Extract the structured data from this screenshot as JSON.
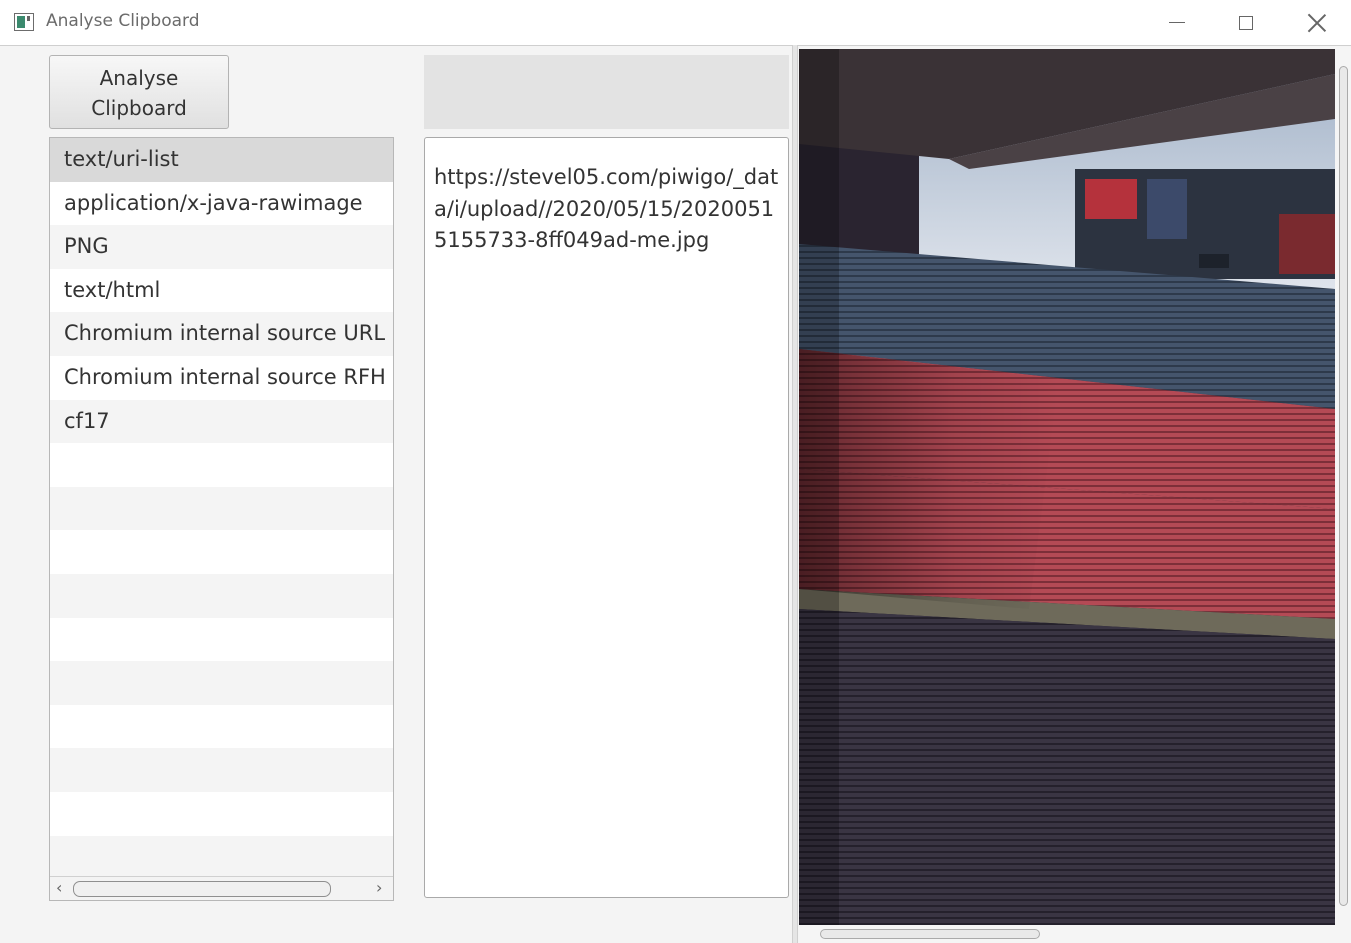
{
  "window": {
    "title": "Analyse Clipboard",
    "controls": [
      "minimize",
      "maximize",
      "close"
    ]
  },
  "toolbar": {
    "analyse_label_line1": "Analyse",
    "analyse_label_line2": "Clipboard"
  },
  "formats": {
    "items": [
      "text/uri-list",
      "application/x-java-rawimage",
      "PNG",
      "text/html",
      "Chromium internal source URL",
      "Chromium internal source RFH token",
      "cf17"
    ],
    "selected_index": 0
  },
  "content": {
    "text": "https://stevel05.com/piwigo/_data/i/upload//2020/05/15/20200515155733-8ff049ad-me.jpg"
  },
  "preview": {
    "description_icon": "stadium-photo"
  },
  "colors": {
    "selected_row": "#d9d9d9",
    "seat_red": "#b44a55",
    "seat_blue": "#3e4f66"
  }
}
